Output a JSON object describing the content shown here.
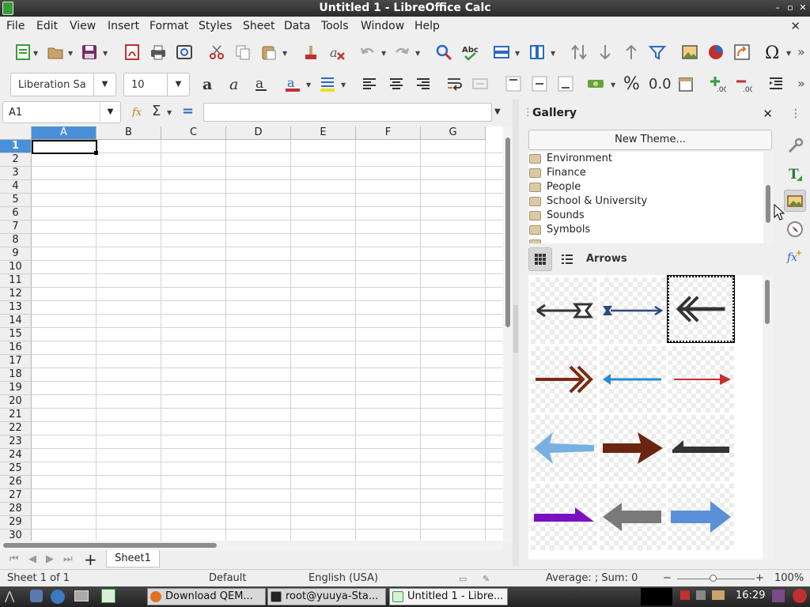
{
  "window": {
    "title": "Untitled 1 - LibreOffice Calc",
    "minimize": "–",
    "maximize": "▫",
    "close": "✕"
  },
  "menubar": {
    "items": [
      "File",
      "Edit",
      "View",
      "Insert",
      "Format",
      "Styles",
      "Sheet",
      "Data",
      "Tools",
      "Window",
      "Help"
    ],
    "doc_close": "✕"
  },
  "format_toolbar": {
    "font_name": "Liberation Sa",
    "font_size": "10",
    "percent_label": "%",
    "decimal_label": "0.0"
  },
  "toolbar_more": "»",
  "formula_bar": {
    "cell_ref": "A1",
    "func_sum": "Σ",
    "equals": "=",
    "value": ""
  },
  "grid": {
    "columns": [
      "A",
      "B",
      "C",
      "D",
      "E",
      "F",
      "G"
    ],
    "rows": [
      "1",
      "2",
      "3",
      "4",
      "5",
      "6",
      "7",
      "8",
      "9",
      "10",
      "11",
      "12",
      "13",
      "14",
      "15",
      "16",
      "17",
      "18",
      "19",
      "20",
      "21",
      "22",
      "23",
      "24",
      "25",
      "26",
      "27",
      "28",
      "29",
      "30"
    ],
    "selected_cell": "A1"
  },
  "sheet_tabs": {
    "add": "+",
    "tabs": [
      "Sheet1"
    ]
  },
  "statusbar": {
    "sheet": "Sheet 1 of 1",
    "page_style": "Default",
    "language": "English (USA)",
    "summary": "Average: ; Sum: 0",
    "zoom_minus": "−",
    "zoom_plus": "+",
    "zoom": "100%"
  },
  "gallery": {
    "title": "Gallery",
    "close": "✕",
    "new_theme": "New Theme...",
    "themes": [
      "Environment",
      "Finance",
      "People",
      "School & University",
      "Sounds",
      "Symbols"
    ],
    "current_theme": "Arrows",
    "view_mode": "icon"
  },
  "taskbar": {
    "tasks": [
      "Download QEM...",
      "root@yuuya-Sta...",
      "Untitled 1 - Libre..."
    ],
    "clock": "16:29"
  },
  "colors": {
    "selection": "#4a90d9",
    "titlebar": "#2b2b2b",
    "accent_green": "#3a9a3a"
  }
}
